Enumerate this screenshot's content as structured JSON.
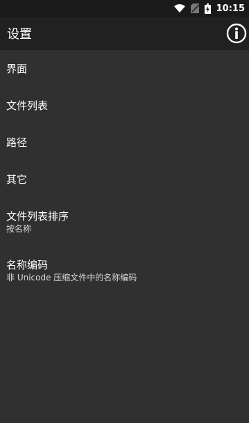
{
  "status_bar": {
    "time": "10:15",
    "icons": [
      "wifi-icon",
      "sim-icon",
      "battery-icon"
    ]
  },
  "app_bar": {
    "title": "设置",
    "info_icon": "info-icon"
  },
  "settings": [
    {
      "title": "界面"
    },
    {
      "title": "文件列表"
    },
    {
      "title": "路径"
    },
    {
      "title": "其它"
    },
    {
      "title": "文件列表排序",
      "summary": "按名称"
    },
    {
      "title": "名称编码",
      "summary": "非 Unicode 压缩文件中的名称编码"
    }
  ],
  "colors": {
    "background": "#303030",
    "app_bar": "#212121",
    "status_bar": "#1a1a1a",
    "text_primary": "#ffffff",
    "text_secondary": "#d8d8d8"
  }
}
